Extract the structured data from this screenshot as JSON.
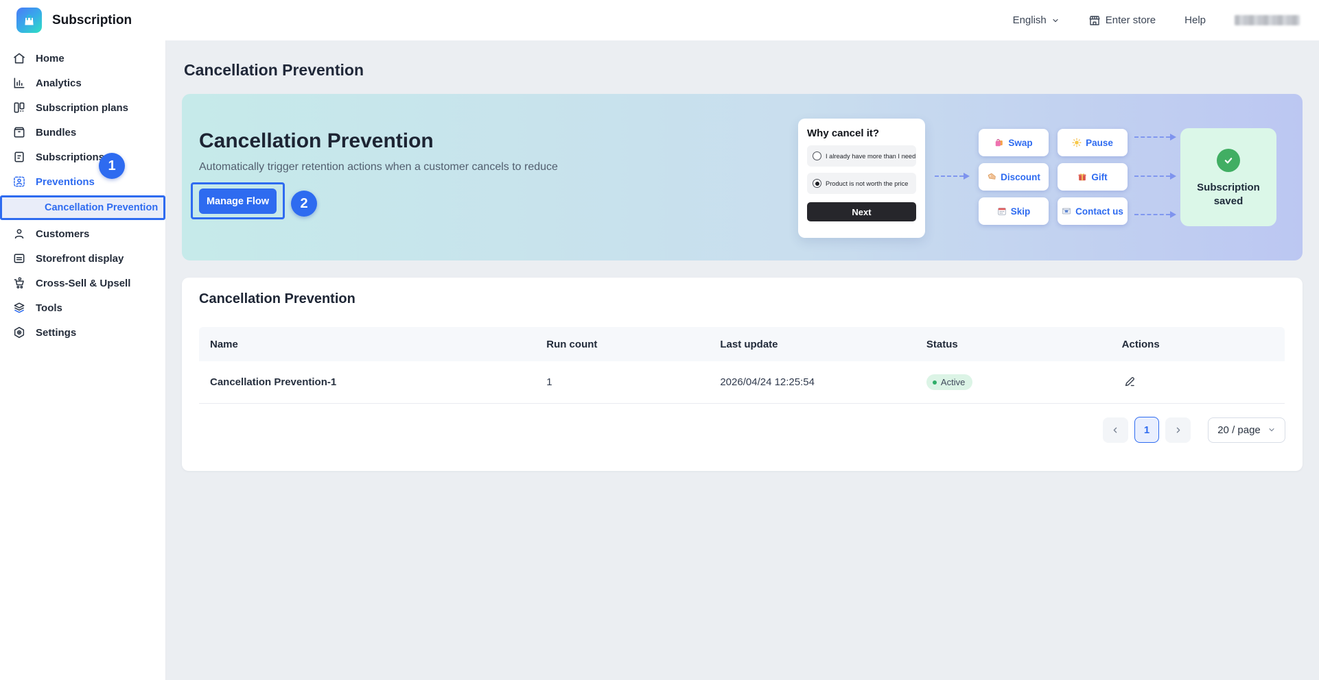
{
  "app": {
    "name": "Subscription"
  },
  "topbar": {
    "language": "English",
    "enter_store_label": "Enter store",
    "help_label": "Help"
  },
  "sidebar": {
    "items": [
      {
        "label": "Home",
        "icon": "home"
      },
      {
        "label": "Analytics",
        "icon": "bar-chart"
      },
      {
        "label": "Subscription plans",
        "icon": "columns"
      },
      {
        "label": "Bundles",
        "icon": "package"
      },
      {
        "label": "Subscriptions",
        "icon": "document"
      },
      {
        "label": "Preventions",
        "icon": "person-dashed",
        "active": true,
        "badge": "1"
      },
      {
        "label": "Cancellation Prevention",
        "type": "sub-item",
        "selected": true
      },
      {
        "label": "Customers",
        "icon": "person"
      },
      {
        "label": "Storefront display",
        "icon": "storefront-panel"
      },
      {
        "label": "Cross-Sell & Upsell",
        "icon": "cart"
      },
      {
        "label": "Tools",
        "icon": "layers"
      },
      {
        "label": "Settings",
        "icon": "gear"
      }
    ]
  },
  "page": {
    "title": "Cancellation Prevention"
  },
  "annotations": {
    "step1": "1",
    "step2": "2"
  },
  "banner": {
    "heading": "Cancellation Prevention",
    "subtitle": "Automatically trigger retention actions when a customer cancels to reduce",
    "manage_flow_label": "Manage Flow",
    "survey": {
      "title": "Why cancel it?",
      "options": [
        {
          "label": "I already have more than I need",
          "selected": false
        },
        {
          "label": "Product is not worth the price",
          "selected": true
        }
      ],
      "next_label": "Next"
    },
    "retention_actions": [
      {
        "label": "Swap",
        "icon": "shopping-bags"
      },
      {
        "label": "Pause",
        "icon": "sun"
      },
      {
        "label": "Discount",
        "icon": "price-tag"
      },
      {
        "label": "Gift",
        "icon": "gift"
      },
      {
        "label": "Skip",
        "icon": "calendar"
      },
      {
        "label": "Contact us",
        "icon": "email"
      }
    ],
    "result": {
      "line1": "Subscription",
      "line2": "saved"
    }
  },
  "table": {
    "heading": "Cancellation Prevention",
    "columns": [
      "Name",
      "Run count",
      "Last update",
      "Status",
      "Actions"
    ],
    "rows": [
      {
        "name": "Cancellation Prevention-1",
        "run_count": "1",
        "last_update": "2026/04/24 12:25:54",
        "status": "Active"
      }
    ]
  },
  "pagination": {
    "current_page": "1",
    "page_size": "20 / page"
  },
  "colors": {
    "accent_blue": "#2e6bf0",
    "success_green": "#41ae63",
    "mint_bg": "#dbf7e8",
    "banner_teal": "#c6eaea",
    "banner_periwinkle": "#bcc7f2",
    "page_bg": "#ebeef2"
  }
}
